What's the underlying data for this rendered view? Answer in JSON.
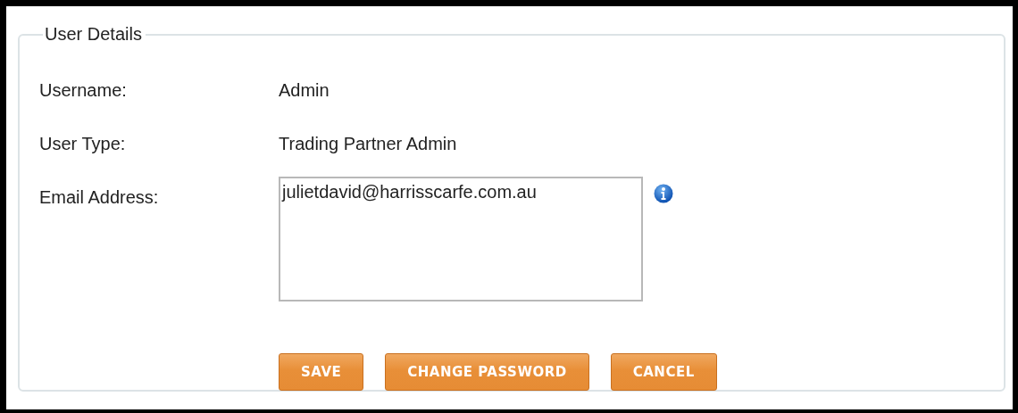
{
  "panel": {
    "title": "User Details"
  },
  "fields": [
    {
      "kind": "text",
      "label": "Username:",
      "value": "Admin"
    },
    {
      "kind": "text",
      "label": "User Type:",
      "value": "Trading Partner Admin"
    },
    {
      "kind": "textarea",
      "label": "Email Address:",
      "value": "julietdavid@harrisscarfe.com.au"
    }
  ],
  "buttons": [
    "SAVE",
    "CHANGE PASSWORD",
    "CANCEL"
  ]
}
